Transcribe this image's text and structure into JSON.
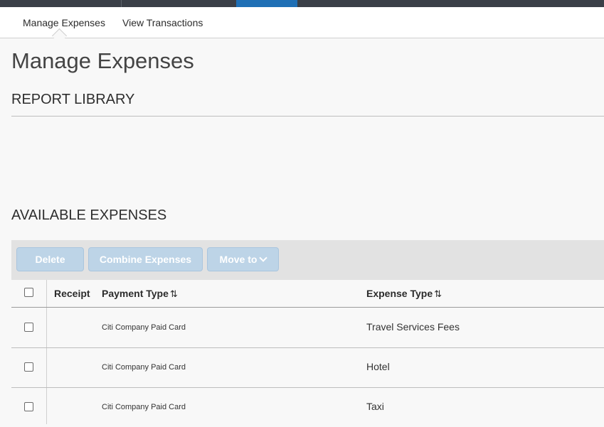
{
  "subnav": {
    "tabs": [
      "Manage Expenses",
      "View Transactions"
    ]
  },
  "page": {
    "title": "Manage Expenses"
  },
  "report_library": {
    "heading": "REPORT LIBRARY"
  },
  "available_expenses": {
    "heading": "AVAILABLE EXPENSES",
    "toolbar": {
      "delete_label": "Delete",
      "combine_label": "Combine Expenses",
      "move_label": "Move to"
    },
    "columns": {
      "receipt": "Receipt",
      "payment_type": "Payment Type",
      "expense_type": "Expense Type",
      "sort_glyph": "⇅"
    },
    "rows": [
      {
        "payment_type": "Citi Company Paid Card",
        "expense_type": "Travel Services Fees"
      },
      {
        "payment_type": "Citi Company Paid Card",
        "expense_type": "Hotel"
      },
      {
        "payment_type": "Citi Company Paid Card",
        "expense_type": "Taxi"
      }
    ]
  },
  "colors": {
    "topbar": "#3a3f47",
    "active_tab": "#1f6fb5",
    "button_disabled": "#bdd4e7",
    "toolbar_bg": "#e2e2e2"
  }
}
